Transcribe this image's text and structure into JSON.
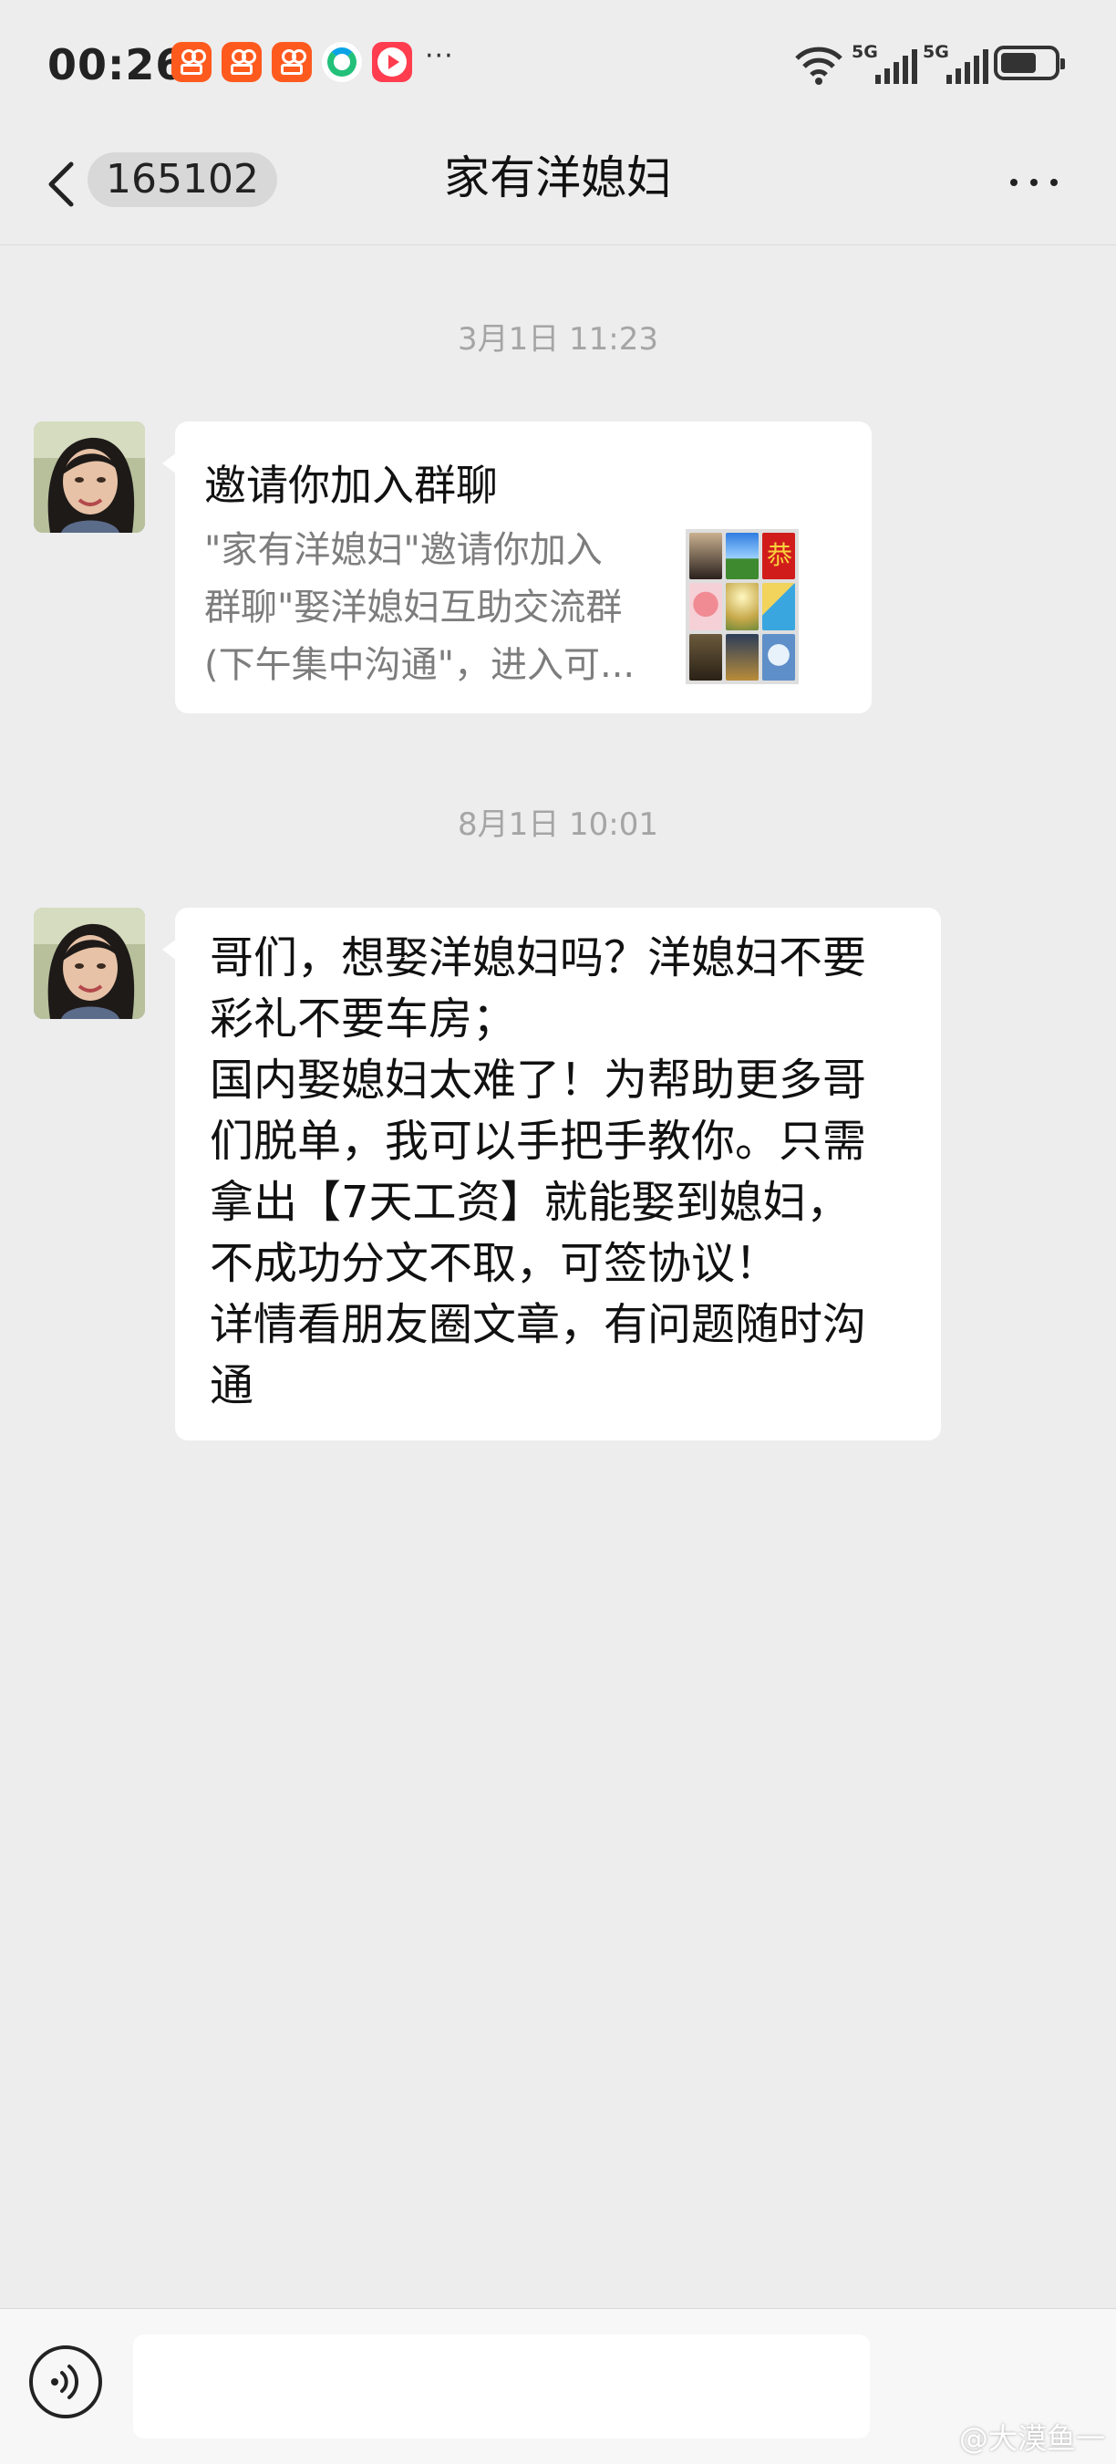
{
  "status_bar": {
    "time": "00:26",
    "notification_icons": [
      "kuaishou-icon",
      "kuaishou-icon",
      "kuaishou-icon",
      "green-app-icon",
      "video-player-icon"
    ],
    "more": "···",
    "network_labels": [
      "5G",
      "5G"
    ]
  },
  "nav": {
    "unread_count": "165102",
    "title": "家有洋媳妇"
  },
  "messages": [
    {
      "timestamp": "3月1日 11:23",
      "type": "group-invite",
      "title": "邀请你加入群聊",
      "desc_lines": [
        "\"家有洋媳妇\"邀请你加入",
        "群聊\"娶洋媳妇互助交流群",
        "(下午集中沟通\"，进入可..."
      ]
    },
    {
      "timestamp": "8月1日 10:01",
      "type": "text",
      "lines": [
        "哥们，想娶洋媳妇吗？洋媳妇不要",
        "彩礼不要车房；",
        "国内娶媳妇太难了！为帮助更多哥",
        "们脱单，我可以手把手教你。只需",
        "拿出【7天工资】就能娶到媳妇，",
        "不成功分文不取，可签协议！",
        "详情看朋友圈文章，有问题随时沟",
        "通"
      ]
    }
  ],
  "input": {
    "value": ""
  },
  "watermark": "@大漠鱼一",
  "colors": {
    "chat_background": "#ededed",
    "bubble": "#ffffff",
    "timestamp": "#a5a5a5",
    "app_orange": "#ff5a1e"
  }
}
